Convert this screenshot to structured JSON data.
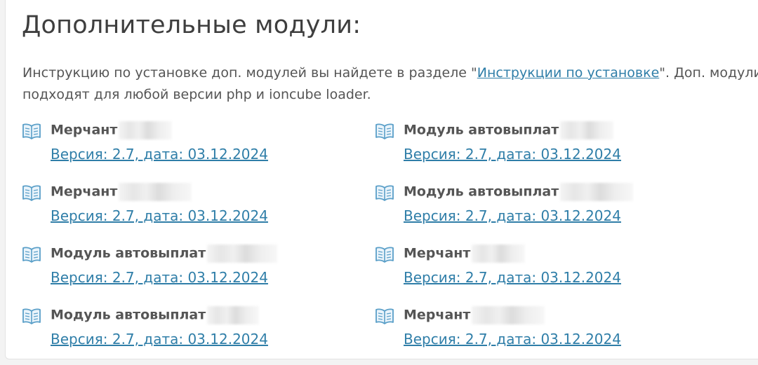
{
  "section": {
    "title": "Дополнительные модули:",
    "intro_before": "Инструкцию по установке доп. модулей вы найдете в разделе \"",
    "intro_link": "Инструкции по установке",
    "intro_after": "\". Доп. модули подходят для любой версии php и ioncube loader."
  },
  "modules": [
    {
      "name": "Мерчант",
      "version": "Версия: 2.7, дата: 03.12.2024"
    },
    {
      "name": "Модуль автовыплат",
      "version": "Версия: 2.7, дата: 03.12.2024"
    },
    {
      "name": "Мерчант",
      "version": "Версия: 2.7, дата: 03.12.2024"
    },
    {
      "name": "Модуль автовыплат",
      "version": "Версия: 2.7, дата: 03.12.2024"
    },
    {
      "name": "Модуль автовыплат",
      "version": "Версия: 2.7, дата: 03.12.2024"
    },
    {
      "name": "Мерчант",
      "version": "Версия: 2.7, дата: 03.12.2024"
    },
    {
      "name": "Модуль автовыплат",
      "version": "Версия: 2.7, дата: 03.12.2024"
    },
    {
      "name": "Мерчант",
      "version": "Версия: 2.7, дата: 03.12.2024"
    }
  ],
  "colors": {
    "heading": "#3e3e3e",
    "text": "#555555",
    "link": "#2f7ea8",
    "icon": "#5a9fc8"
  },
  "icon_name": "open-book-icon"
}
